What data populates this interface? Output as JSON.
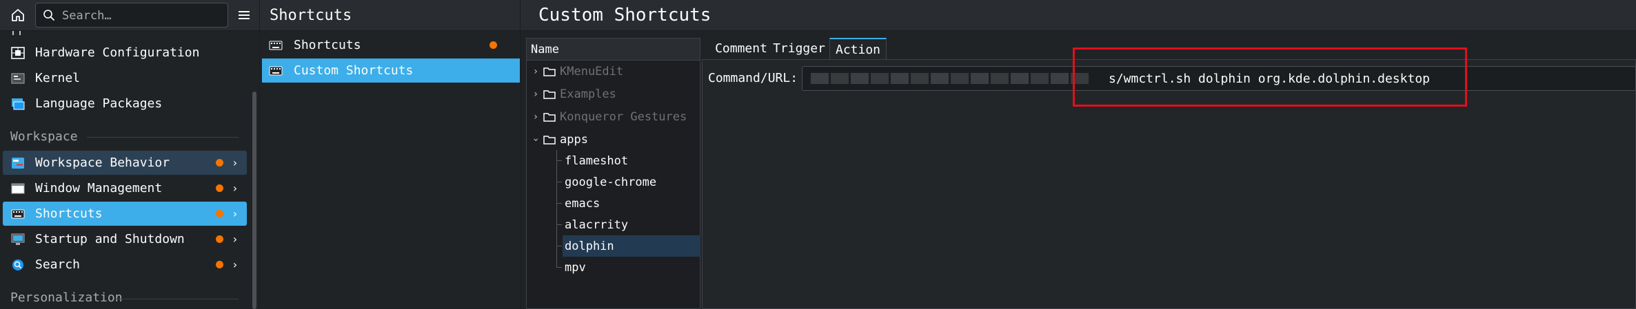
{
  "sidebar": {
    "search_placeholder": "Search…",
    "items_top": [
      {
        "label": "Hardware Configuration",
        "icon": "hardware-icon"
      },
      {
        "label": "Kernel",
        "icon": "kernel-icon"
      },
      {
        "label": "Language Packages",
        "icon": "language-packages-icon"
      }
    ],
    "section_workspace": "Workspace",
    "workspace_items": [
      {
        "label": "Workspace Behavior",
        "icon": "workspace-behavior-icon"
      },
      {
        "label": "Window Management",
        "icon": "window-management-icon"
      },
      {
        "label": "Shortcuts",
        "icon": "keyboard-icon"
      },
      {
        "label": "Startup and Shutdown",
        "icon": "startup-shutdown-icon"
      },
      {
        "label": "Search",
        "icon": "search-module-icon"
      }
    ],
    "section_personalization": "Personalization"
  },
  "middle": {
    "title": "Shortcuts",
    "items": [
      {
        "label": "Shortcuts",
        "icon": "keyboard-icon"
      },
      {
        "label": "Custom Shortcuts",
        "icon": "keyboard-icon"
      }
    ]
  },
  "main": {
    "title": "Custom Shortcuts",
    "tree": {
      "header": "Name",
      "groups": [
        "KMenuEdit",
        "Examples",
        "Konqueror Gestures",
        "apps"
      ],
      "apps": [
        "flameshot",
        "google-chrome",
        "emacs",
        "alacrrity",
        "dolphin",
        "mpv"
      ]
    },
    "tabs": [
      "Comment",
      "Trigger",
      "Action"
    ],
    "command_label": "Command/URL:",
    "command_value": "s/wmctrl.sh dolphin org.kde.dolphin.desktop"
  },
  "colors": {
    "accent": "#3daee9",
    "hover": "#2c4154",
    "selected_child": "#233b52",
    "badge": "#f67400",
    "highlight": "#e0101a",
    "background": "#202326"
  }
}
